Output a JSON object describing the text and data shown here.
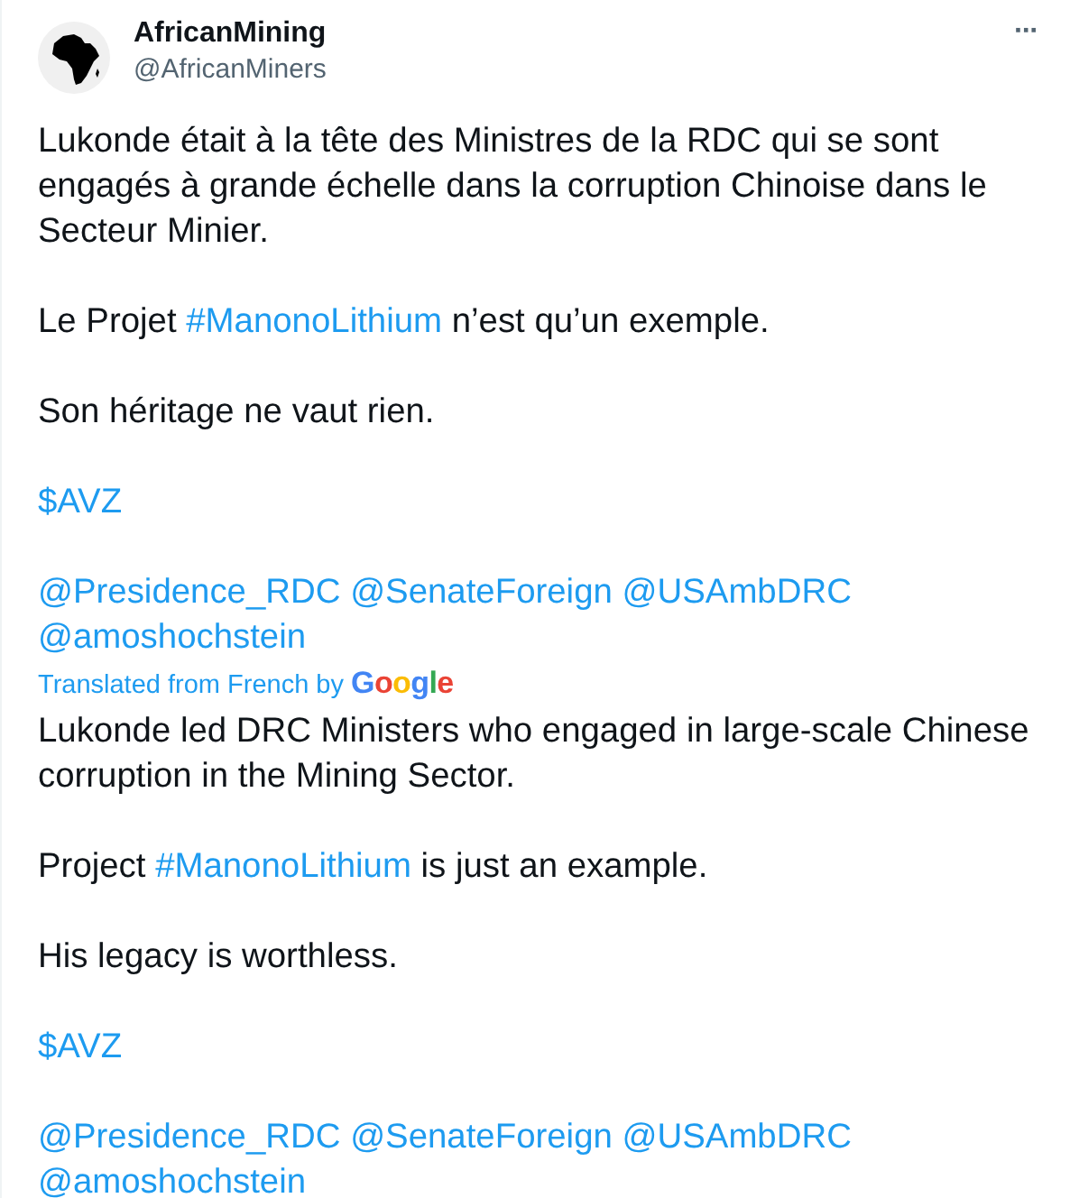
{
  "author": {
    "name": "AfricanMining",
    "handle": "@AfricanMiners"
  },
  "more_button": "···",
  "original": [
    [
      {
        "kind": "text",
        "text": "Lukonde était à la tête des Ministres de la RDC qui se sont engagés à grande échelle dans la corruption Chinoise dans le Secteur Minier."
      }
    ],
    [
      {
        "kind": "text",
        "text": "Le Projet "
      },
      {
        "kind": "link",
        "text": "#ManonoLithium"
      },
      {
        "kind": "text",
        "text": " n’est qu’un exemple."
      }
    ],
    [
      {
        "kind": "text",
        "text": "Son héritage ne vaut rien."
      }
    ],
    [
      {
        "kind": "link",
        "text": "$AVZ"
      }
    ],
    [
      {
        "kind": "link",
        "text": "@Presidence_RDC"
      },
      {
        "kind": "link",
        "text": "@SenateForeign"
      },
      {
        "kind": "link",
        "text": "@USAmbDRC"
      },
      {
        "kind": "link",
        "text": "@amoshochstein"
      }
    ]
  ],
  "translation_note": {
    "text": "Translated from French by",
    "provider": "Google"
  },
  "translated": [
    [
      {
        "kind": "text",
        "text": "Lukonde led DRC Ministers who engaged in large-scale Chinese corruption in the Mining Sector."
      }
    ],
    [
      {
        "kind": "text",
        "text": "Project "
      },
      {
        "kind": "link",
        "text": "#ManonoLithium"
      },
      {
        "kind": "text",
        "text": " is just an example."
      }
    ],
    [
      {
        "kind": "text",
        "text": "His legacy is worthless."
      }
    ],
    [
      {
        "kind": "link",
        "text": "$AVZ"
      }
    ],
    [
      {
        "kind": "link",
        "text": "@Presidence_RDC"
      },
      {
        "kind": "link",
        "text": "@SenateForeign"
      },
      {
        "kind": "link",
        "text": "@USAmbDRC"
      },
      {
        "kind": "link",
        "text": "@amoshochstein"
      }
    ]
  ]
}
